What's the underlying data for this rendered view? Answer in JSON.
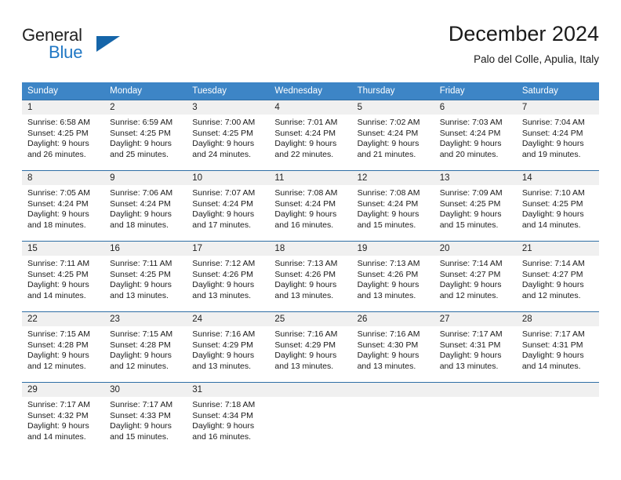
{
  "brand": {
    "name_primary": "General",
    "name_secondary": "Blue",
    "logo_icon": "triangle-logo-icon",
    "accent_color": "#1f77c4"
  },
  "header": {
    "title": "December 2024",
    "subtitle": "Palo del Colle, Apulia, Italy"
  },
  "calendar": {
    "header_color": "#3d85c6",
    "daynum_band_color": "#f0f0f0",
    "weekdays": [
      "Sunday",
      "Monday",
      "Tuesday",
      "Wednesday",
      "Thursday",
      "Friday",
      "Saturday"
    ],
    "weeks": [
      [
        {
          "day": "1",
          "sunrise": "Sunrise: 6:58 AM",
          "sunset": "Sunset: 4:25 PM",
          "daylight_line1": "Daylight: 9 hours",
          "daylight_line2": "and 26 minutes."
        },
        {
          "day": "2",
          "sunrise": "Sunrise: 6:59 AM",
          "sunset": "Sunset: 4:25 PM",
          "daylight_line1": "Daylight: 9 hours",
          "daylight_line2": "and 25 minutes."
        },
        {
          "day": "3",
          "sunrise": "Sunrise: 7:00 AM",
          "sunset": "Sunset: 4:25 PM",
          "daylight_line1": "Daylight: 9 hours",
          "daylight_line2": "and 24 minutes."
        },
        {
          "day": "4",
          "sunrise": "Sunrise: 7:01 AM",
          "sunset": "Sunset: 4:24 PM",
          "daylight_line1": "Daylight: 9 hours",
          "daylight_line2": "and 22 minutes."
        },
        {
          "day": "5",
          "sunrise": "Sunrise: 7:02 AM",
          "sunset": "Sunset: 4:24 PM",
          "daylight_line1": "Daylight: 9 hours",
          "daylight_line2": "and 21 minutes."
        },
        {
          "day": "6",
          "sunrise": "Sunrise: 7:03 AM",
          "sunset": "Sunset: 4:24 PM",
          "daylight_line1": "Daylight: 9 hours",
          "daylight_line2": "and 20 minutes."
        },
        {
          "day": "7",
          "sunrise": "Sunrise: 7:04 AM",
          "sunset": "Sunset: 4:24 PM",
          "daylight_line1": "Daylight: 9 hours",
          "daylight_line2": "and 19 minutes."
        }
      ],
      [
        {
          "day": "8",
          "sunrise": "Sunrise: 7:05 AM",
          "sunset": "Sunset: 4:24 PM",
          "daylight_line1": "Daylight: 9 hours",
          "daylight_line2": "and 18 minutes."
        },
        {
          "day": "9",
          "sunrise": "Sunrise: 7:06 AM",
          "sunset": "Sunset: 4:24 PM",
          "daylight_line1": "Daylight: 9 hours",
          "daylight_line2": "and 18 minutes."
        },
        {
          "day": "10",
          "sunrise": "Sunrise: 7:07 AM",
          "sunset": "Sunset: 4:24 PM",
          "daylight_line1": "Daylight: 9 hours",
          "daylight_line2": "and 17 minutes."
        },
        {
          "day": "11",
          "sunrise": "Sunrise: 7:08 AM",
          "sunset": "Sunset: 4:24 PM",
          "daylight_line1": "Daylight: 9 hours",
          "daylight_line2": "and 16 minutes."
        },
        {
          "day": "12",
          "sunrise": "Sunrise: 7:08 AM",
          "sunset": "Sunset: 4:24 PM",
          "daylight_line1": "Daylight: 9 hours",
          "daylight_line2": "and 15 minutes."
        },
        {
          "day": "13",
          "sunrise": "Sunrise: 7:09 AM",
          "sunset": "Sunset: 4:25 PM",
          "daylight_line1": "Daylight: 9 hours",
          "daylight_line2": "and 15 minutes."
        },
        {
          "day": "14",
          "sunrise": "Sunrise: 7:10 AM",
          "sunset": "Sunset: 4:25 PM",
          "daylight_line1": "Daylight: 9 hours",
          "daylight_line2": "and 14 minutes."
        }
      ],
      [
        {
          "day": "15",
          "sunrise": "Sunrise: 7:11 AM",
          "sunset": "Sunset: 4:25 PM",
          "daylight_line1": "Daylight: 9 hours",
          "daylight_line2": "and 14 minutes."
        },
        {
          "day": "16",
          "sunrise": "Sunrise: 7:11 AM",
          "sunset": "Sunset: 4:25 PM",
          "daylight_line1": "Daylight: 9 hours",
          "daylight_line2": "and 13 minutes."
        },
        {
          "day": "17",
          "sunrise": "Sunrise: 7:12 AM",
          "sunset": "Sunset: 4:26 PM",
          "daylight_line1": "Daylight: 9 hours",
          "daylight_line2": "and 13 minutes."
        },
        {
          "day": "18",
          "sunrise": "Sunrise: 7:13 AM",
          "sunset": "Sunset: 4:26 PM",
          "daylight_line1": "Daylight: 9 hours",
          "daylight_line2": "and 13 minutes."
        },
        {
          "day": "19",
          "sunrise": "Sunrise: 7:13 AM",
          "sunset": "Sunset: 4:26 PM",
          "daylight_line1": "Daylight: 9 hours",
          "daylight_line2": "and 13 minutes."
        },
        {
          "day": "20",
          "sunrise": "Sunrise: 7:14 AM",
          "sunset": "Sunset: 4:27 PM",
          "daylight_line1": "Daylight: 9 hours",
          "daylight_line2": "and 12 minutes."
        },
        {
          "day": "21",
          "sunrise": "Sunrise: 7:14 AM",
          "sunset": "Sunset: 4:27 PM",
          "daylight_line1": "Daylight: 9 hours",
          "daylight_line2": "and 12 minutes."
        }
      ],
      [
        {
          "day": "22",
          "sunrise": "Sunrise: 7:15 AM",
          "sunset": "Sunset: 4:28 PM",
          "daylight_line1": "Daylight: 9 hours",
          "daylight_line2": "and 12 minutes."
        },
        {
          "day": "23",
          "sunrise": "Sunrise: 7:15 AM",
          "sunset": "Sunset: 4:28 PM",
          "daylight_line1": "Daylight: 9 hours",
          "daylight_line2": "and 12 minutes."
        },
        {
          "day": "24",
          "sunrise": "Sunrise: 7:16 AM",
          "sunset": "Sunset: 4:29 PM",
          "daylight_line1": "Daylight: 9 hours",
          "daylight_line2": "and 13 minutes."
        },
        {
          "day": "25",
          "sunrise": "Sunrise: 7:16 AM",
          "sunset": "Sunset: 4:29 PM",
          "daylight_line1": "Daylight: 9 hours",
          "daylight_line2": "and 13 minutes."
        },
        {
          "day": "26",
          "sunrise": "Sunrise: 7:16 AM",
          "sunset": "Sunset: 4:30 PM",
          "daylight_line1": "Daylight: 9 hours",
          "daylight_line2": "and 13 minutes."
        },
        {
          "day": "27",
          "sunrise": "Sunrise: 7:17 AM",
          "sunset": "Sunset: 4:31 PM",
          "daylight_line1": "Daylight: 9 hours",
          "daylight_line2": "and 13 minutes."
        },
        {
          "day": "28",
          "sunrise": "Sunrise: 7:17 AM",
          "sunset": "Sunset: 4:31 PM",
          "daylight_line1": "Daylight: 9 hours",
          "daylight_line2": "and 14 minutes."
        }
      ],
      [
        {
          "day": "29",
          "sunrise": "Sunrise: 7:17 AM",
          "sunset": "Sunset: 4:32 PM",
          "daylight_line1": "Daylight: 9 hours",
          "daylight_line2": "and 14 minutes."
        },
        {
          "day": "30",
          "sunrise": "Sunrise: 7:17 AM",
          "sunset": "Sunset: 4:33 PM",
          "daylight_line1": "Daylight: 9 hours",
          "daylight_line2": "and 15 minutes."
        },
        {
          "day": "31",
          "sunrise": "Sunrise: 7:18 AM",
          "sunset": "Sunset: 4:34 PM",
          "daylight_line1": "Daylight: 9 hours",
          "daylight_line2": "and 16 minutes."
        },
        {
          "day": "",
          "sunrise": "",
          "sunset": "",
          "daylight_line1": "",
          "daylight_line2": ""
        },
        {
          "day": "",
          "sunrise": "",
          "sunset": "",
          "daylight_line1": "",
          "daylight_line2": ""
        },
        {
          "day": "",
          "sunrise": "",
          "sunset": "",
          "daylight_line1": "",
          "daylight_line2": ""
        },
        {
          "day": "",
          "sunrise": "",
          "sunset": "",
          "daylight_line1": "",
          "daylight_line2": ""
        }
      ]
    ]
  }
}
